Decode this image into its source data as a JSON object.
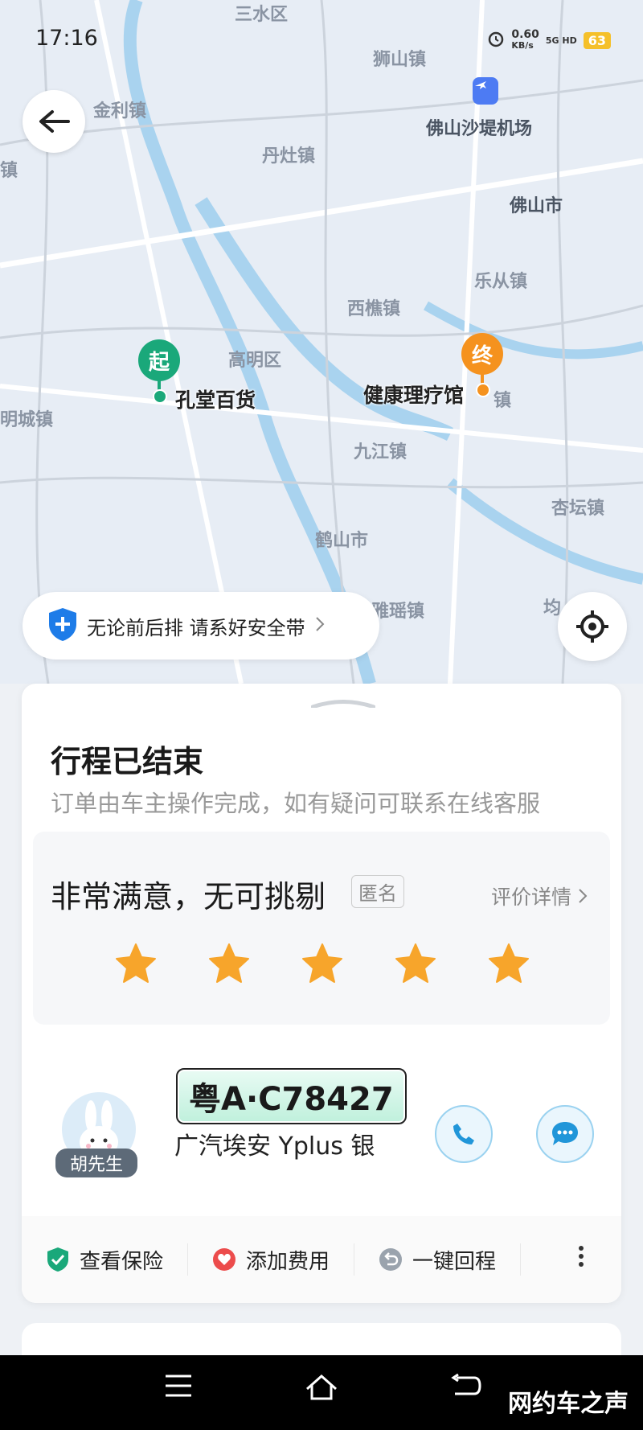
{
  "status_bar": {
    "time": "17:16",
    "net_speed": "0.60",
    "net_unit": "KB/s",
    "signal": "5G HD",
    "battery": "63"
  },
  "map": {
    "labels": [
      {
        "text": "三水区",
        "style": "light"
      },
      {
        "text": "狮山镇",
        "style": "light"
      },
      {
        "text": "金利镇",
        "style": "light"
      },
      {
        "text": "佛山沙堤机场",
        "style": "dark"
      },
      {
        "text": "丹灶镇",
        "style": "light"
      },
      {
        "text": "镇",
        "style": "light"
      },
      {
        "text": "佛山市",
        "style": "dark"
      },
      {
        "text": "乐从镇",
        "style": "light"
      },
      {
        "text": "西樵镇",
        "style": "light"
      },
      {
        "text": "高明区",
        "style": "light"
      },
      {
        "text": "明城镇",
        "style": "light"
      },
      {
        "text": "九江镇",
        "style": "light"
      },
      {
        "text": "杏坛镇",
        "style": "light"
      },
      {
        "text": "鹤山市",
        "style": "light"
      },
      {
        "text": "雅瑶镇",
        "style": "light"
      },
      {
        "text": "均",
        "style": "light"
      },
      {
        "text": "镇",
        "style": "light"
      }
    ],
    "start": {
      "badge": "起",
      "name": "孔堂百货"
    },
    "end": {
      "badge": "终",
      "name": "健康理疗馆"
    },
    "end_suffix": "镇"
  },
  "safety_tip": "无论前后排 请系好安全带",
  "trip": {
    "title": "行程已结束",
    "subtitle": "订单由车主操作完成，如有疑问可联系在线客服"
  },
  "rating": {
    "text": "非常满意，无可挑剔",
    "anonymous": "匿名",
    "detail_link": "评价详情",
    "stars": 5,
    "star_color": "#f7a52b"
  },
  "driver": {
    "name": "胡先生",
    "plate": "粤A·C78427",
    "car": "广汽埃安 Yplus 银"
  },
  "actions": [
    {
      "label": "查看保险",
      "icon": "shield-check-icon"
    },
    {
      "label": "添加费用",
      "icon": "heart-tag-icon"
    },
    {
      "label": "一键回程",
      "icon": "return-icon"
    }
  ],
  "watermark": "网约车之声",
  "colors": {
    "start": "#1aa87a",
    "end": "#f5921e",
    "accent": "#2196d9"
  }
}
